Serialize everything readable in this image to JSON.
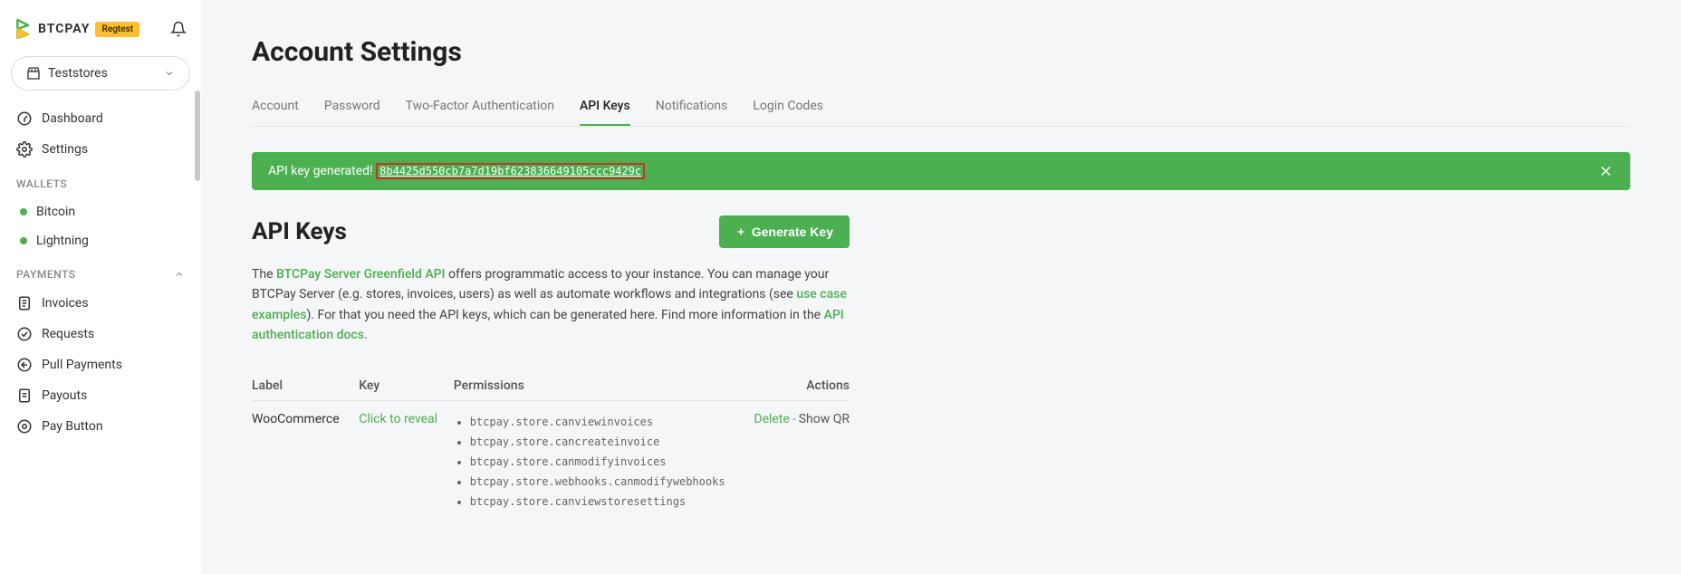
{
  "header": {
    "logo_text": "BTCPAY",
    "badge": "Regtest"
  },
  "store_selector": {
    "name": "Teststores"
  },
  "nav": {
    "dashboard": "Dashboard",
    "settings": "Settings"
  },
  "sections": {
    "wallets": "WALLETS",
    "payments": "PAYMENTS"
  },
  "wallets": {
    "bitcoin": "Bitcoin",
    "lightning": "Lightning"
  },
  "payments": {
    "invoices": "Invoices",
    "requests": "Requests",
    "pull": "Pull Payments",
    "payouts": "Payouts",
    "pay_button": "Pay Button"
  },
  "page": {
    "title": "Account Settings"
  },
  "tabs": {
    "account": "Account",
    "password": "Password",
    "two_factor": "Two-Factor Authentication",
    "api_keys": "API Keys",
    "notifications": "Notifications",
    "login_codes": "Login Codes"
  },
  "alert": {
    "prefix": "API key generated! ",
    "key": "8b4425d550cb7a7d19bf623836649105ccc9429c"
  },
  "api_keys": {
    "title": "API Keys",
    "generate_btn": "Generate Key",
    "desc_pre": "The ",
    "desc_link1": "BTCPay Server Greenfield API",
    "desc_mid1": " offers programmatic access to your instance. You can manage your BTCPay Server (e.g. stores, invoices, users) as well as automate workflows and integrations (see ",
    "desc_link2": "use case examples",
    "desc_mid2": "). For that you need the API keys, which can be generated here. Find more information in the ",
    "desc_link3": "API authentication docs",
    "desc_end": "."
  },
  "table": {
    "h_label": "Label",
    "h_key": "Key",
    "h_permissions": "Permissions",
    "h_actions": "Actions"
  },
  "row": {
    "label": "WooCommerce",
    "reveal": "Click to reveal",
    "delete": "Delete",
    "showqr": "Show QR",
    "perms": [
      "btcpay.store.canviewinvoices",
      "btcpay.store.cancreateinvoice",
      "btcpay.store.canmodifyinvoices",
      "btcpay.store.webhooks.canmodifywebhooks",
      "btcpay.store.canviewstoresettings"
    ]
  }
}
